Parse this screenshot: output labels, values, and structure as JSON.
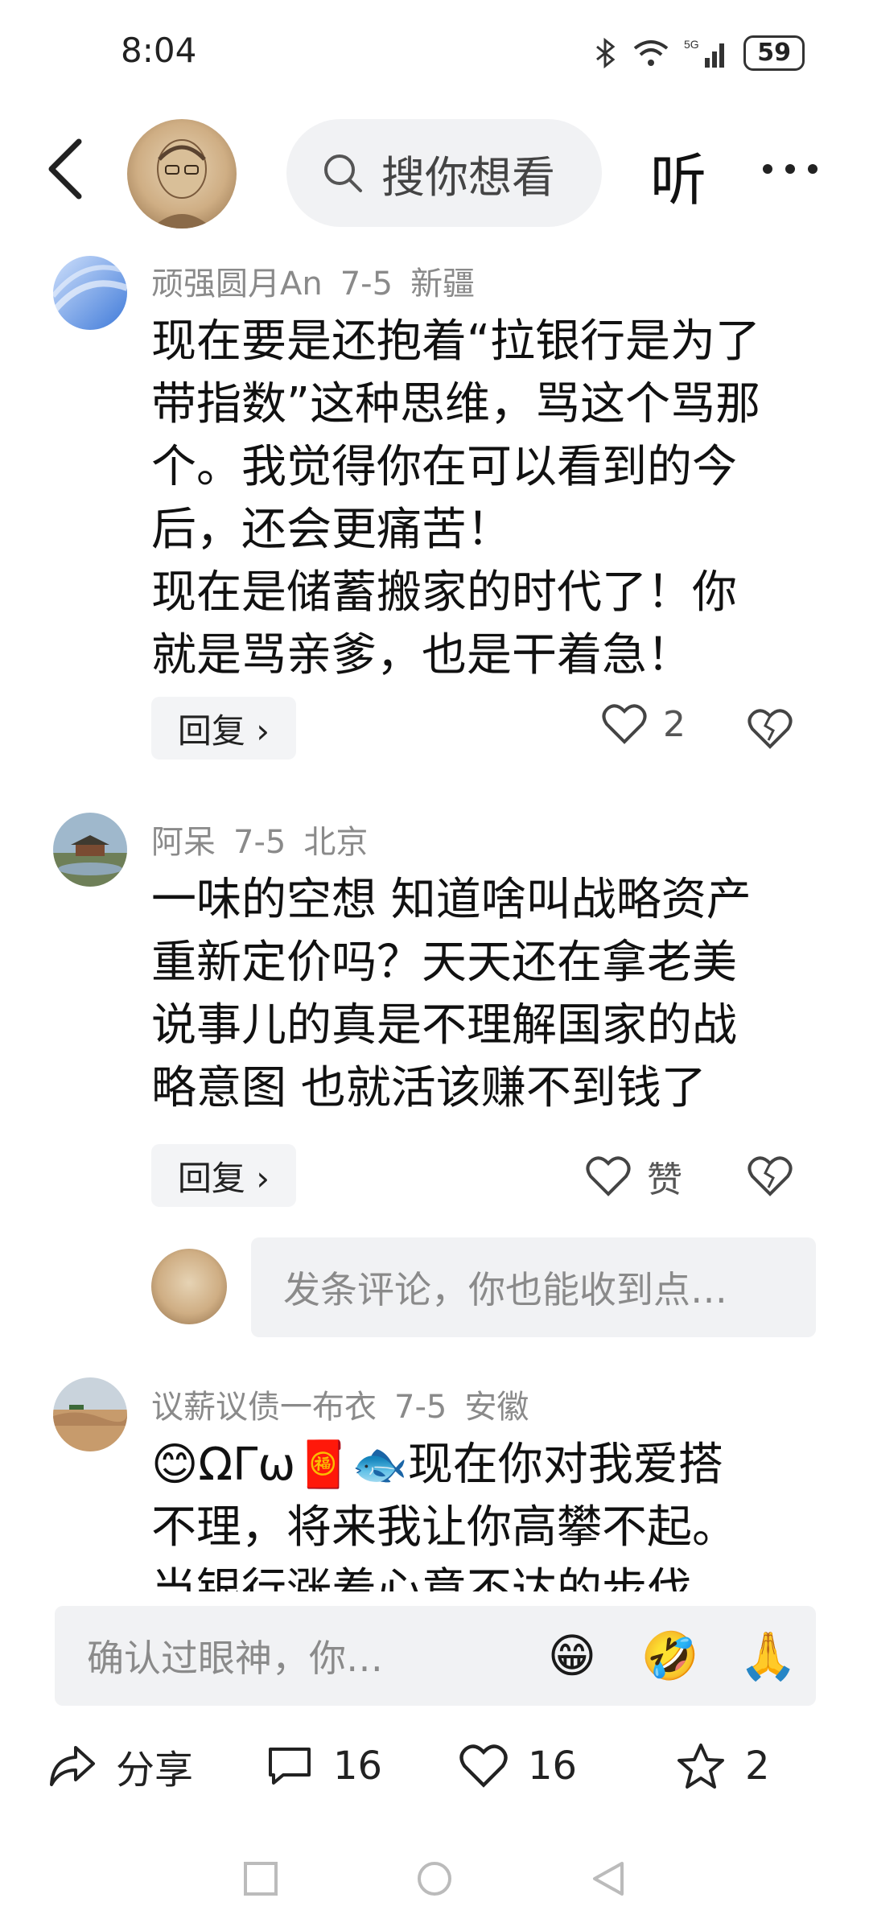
{
  "status": {
    "time": "8:04",
    "battery": "59",
    "network": "5G"
  },
  "topbar": {
    "search_placeholder": "搜你想看",
    "listen_label": "听"
  },
  "comments": [
    {
      "user": "顽强圆月An",
      "date": "7-5",
      "location": "新疆",
      "lines": [
        "现在要是还抱着“拉银行是为了",
        "带指数”这种思维，骂这个骂那",
        "个。我觉得你在可以看到的今",
        "后，还会更痛苦！",
        "现在是储蓄搬家的时代了！你",
        "就是骂亲爹，也是干着急！"
      ],
      "reply_label": "回复 ›",
      "likes": "2"
    },
    {
      "user": "阿呆",
      "date": "7-5",
      "location": "北京",
      "lines": [
        "一味的空想 知道啥叫战略资产",
        "重新定价吗？天天还在拿老美",
        "说事儿的真是不理解国家的战",
        "略意图 也就活该赚不到钱了"
      ],
      "reply_label": "回复 ›",
      "likes": "赞"
    },
    {
      "user": "议薪议债一布衣",
      "date": "7-5",
      "location": "安徽",
      "lines": [
        "😊ΩΓω🧧🐟现在你对我爱搭",
        "不理，将来我让你高攀不起。",
        "当银行涨着心意不达的步伐"
      ]
    }
  ],
  "reply_input_placeholder": "发条评论，你也能收到点…",
  "comment_bar": {
    "placeholder": "确认过眼神，你…",
    "emojis": [
      "😁",
      "🤣",
      "🙏"
    ]
  },
  "actions": {
    "share": "分享",
    "comments": "16",
    "likes": "16",
    "favorites": "2"
  },
  "colors": {
    "meta": "#8a8a8a",
    "input_bg": "#f1f2f4"
  }
}
